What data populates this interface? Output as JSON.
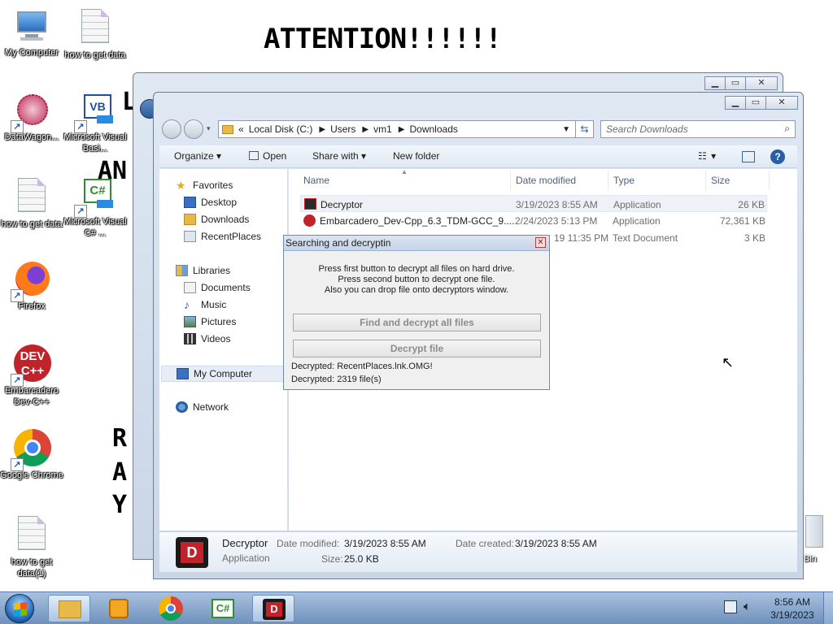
{
  "wallpaper": {
    "title": "ATTENTION!!!!!!",
    "fragments": [
      "L",
      "AN",
      "R",
      "A",
      "Y"
    ]
  },
  "desktop_icons": [
    {
      "label": "My Computer",
      "icon": "computer-icon"
    },
    {
      "label": "how to get data",
      "icon": "text-document-icon"
    },
    {
      "label": "DataWagon...",
      "icon": "datawagon-icon"
    },
    {
      "label": "Microsoft Visual Basi...",
      "icon": "visual-basic-icon"
    },
    {
      "label": "how to get data",
      "icon": "text-document-icon"
    },
    {
      "label": "Microsoft Visual C# ...",
      "icon": "visual-csharp-icon"
    },
    {
      "label": "Firefox",
      "icon": "firefox-icon"
    },
    {
      "label": "Embarcadero Dev-C++",
      "icon": "devcpp-icon"
    },
    {
      "label": "Google Chrome",
      "icon": "chrome-icon"
    },
    {
      "label": "how to get data(1)",
      "icon": "text-document-icon"
    },
    {
      "label": "Bin",
      "icon": "recycle-bin-icon"
    }
  ],
  "explorer": {
    "breadcrumb": [
      "«",
      "Local Disk (C:)",
      "Users",
      "vm1",
      "Downloads"
    ],
    "search_placeholder": "Search Downloads",
    "toolbar": {
      "organize": "Organize",
      "open": "Open",
      "share_with": "Share with",
      "new_folder": "New folder"
    },
    "nav": {
      "favorites_header": "Favorites",
      "favorites": [
        "Desktop",
        "Downloads",
        "RecentPlaces"
      ],
      "libraries_header": "Libraries",
      "libraries": [
        "Documents",
        "Music",
        "Pictures",
        "Videos"
      ],
      "my_computer": "My Computer",
      "network": "Network"
    },
    "columns": [
      "Name",
      "Date modified",
      "Type",
      "Size"
    ],
    "files": [
      {
        "name": "Decryptor",
        "date": "3/19/2023 8:55 AM",
        "type": "Application",
        "size": "26 KB"
      },
      {
        "name": "Embarcadero_Dev-Cpp_6.3_TDM-GCC_9....",
        "date": "2/24/2023 5:13 PM",
        "type": "Application",
        "size": "72,361 KB"
      },
      {
        "name": "",
        "date": "19 11:35 PM",
        "type": "Text Document",
        "size": "3 KB"
      }
    ],
    "details": {
      "name": "Decryptor",
      "kind": "Application",
      "date_modified_label": "Date modified:",
      "date_modified": "3/19/2023 8:55 AM",
      "date_created_label": "Date created:",
      "date_created": "3/19/2023 8:55 AM",
      "size_label": "Size:",
      "size": "25.0 KB",
      "icon_letter": "D"
    }
  },
  "dialog": {
    "title": "Searching and decryptin",
    "instructions": [
      "Press first button to decrypt all files on hard drive.",
      "Press second button to decrypt one file.",
      "Also you can drop file onto decryptors window."
    ],
    "btn_all": "Find and decrypt all files",
    "btn_one": "Decrypt file",
    "status_file": "Decrypted: RecentPlaces.lnk.OMG!",
    "status_count": "Decrypted: 2319 file(s)"
  },
  "taskbar": {
    "clock_time": "8:56 AM",
    "clock_date": "3/19/2023",
    "csharp_label": "C#",
    "decryptor_letter": "D"
  },
  "colors": {
    "accent": "#2a5ea8",
    "taskbar": "#8aa9cf",
    "dev_red": "#c0242a"
  }
}
